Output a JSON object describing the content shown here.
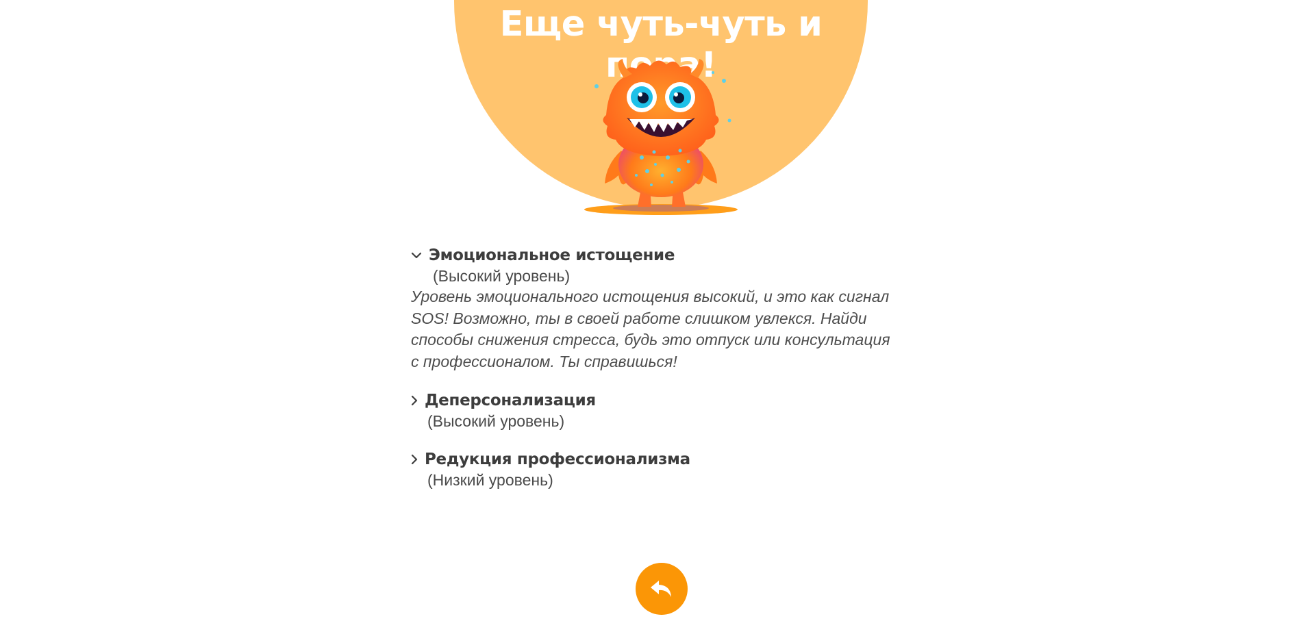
{
  "hero": {
    "title": "Еще чуть-чуть и пора!",
    "circle_color": "#ffc46e",
    "image_icon": "orange-monster-illustration"
  },
  "results": [
    {
      "title": "Эмоциональное истощение",
      "level": "(Высокий уровень)",
      "expanded": true,
      "description": "Уровень эмоционального истощения высокий, и это как сигнал SOS! Возможно, ты в своей работе слишком увлекся. Найди способы снижения стресса, будь это отпуск или консультация с профессионалом. Ты справишься!"
    },
    {
      "title": "Деперсонализация",
      "level": "(Высокий уровень)",
      "expanded": false
    },
    {
      "title": "Редукция профессионализма",
      "level": "(Низкий уровень)",
      "expanded": false
    }
  ],
  "back_button": {
    "icon": "back-arrow-icon",
    "color": "#fb9606"
  }
}
